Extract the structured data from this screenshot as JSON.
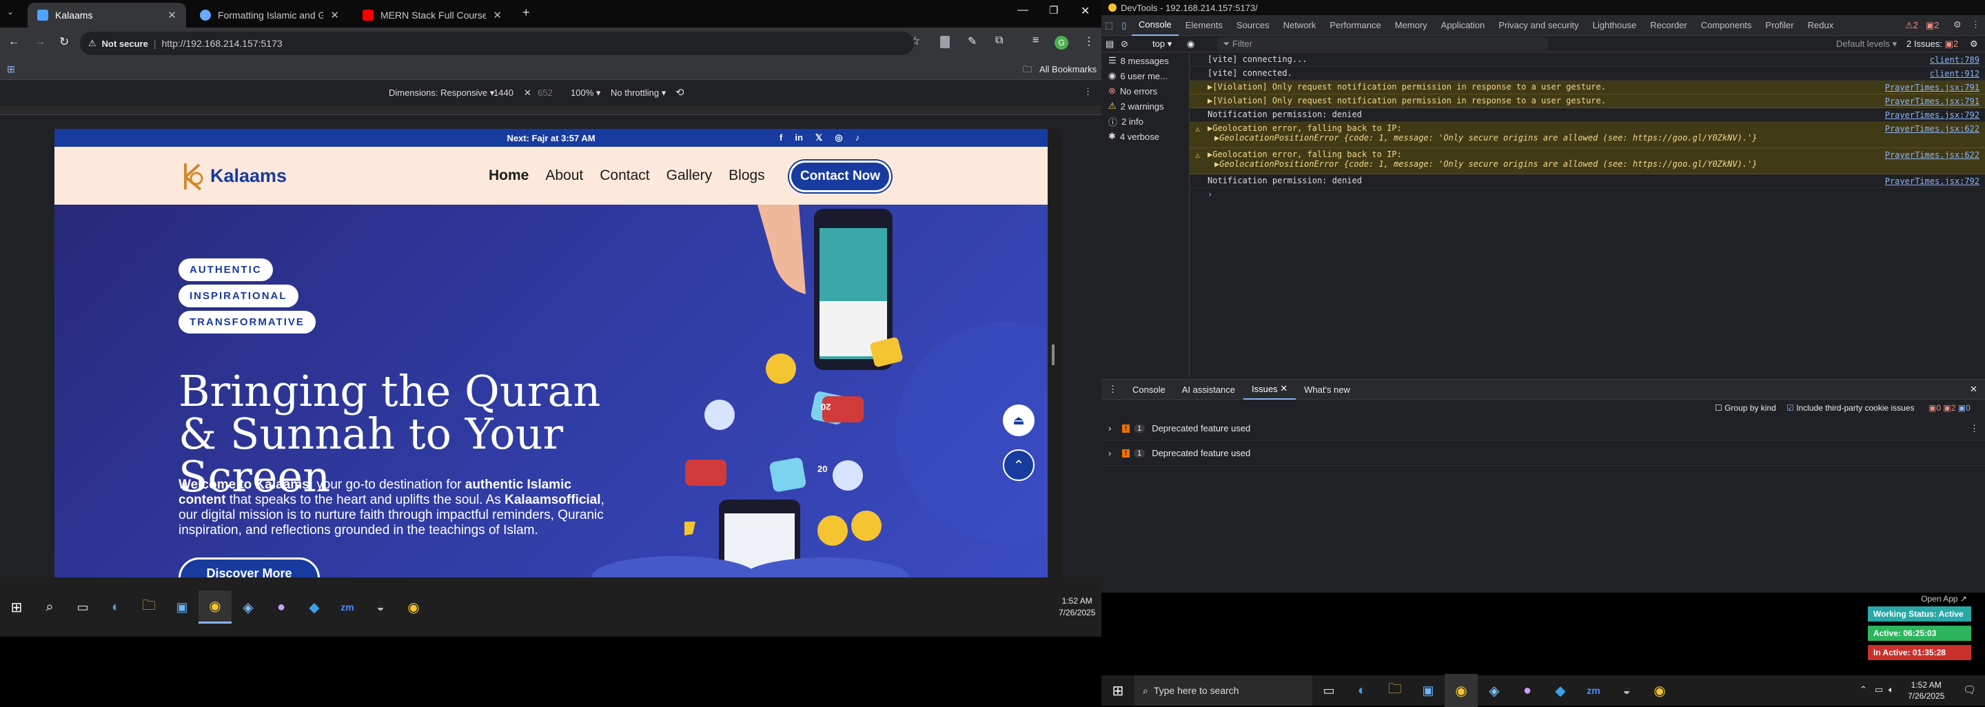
{
  "browser": {
    "tabs": [
      {
        "title": "Kalaams",
        "active": true,
        "color": "#4fa3ff"
      },
      {
        "title": "Formatting Islamic and Gregor...",
        "active": false,
        "color": "#6aa9ff"
      },
      {
        "title": "MERN Stack Full Course - ECom...",
        "active": false,
        "color": "#ff0000"
      }
    ],
    "new_tab_icon": "plus-icon",
    "security_label": "Not secure",
    "url": "http://192.168.214.157:5173",
    "all_bookmarks": "All Bookmarks",
    "device_bar": {
      "dimensions_label": "Dimensions: Responsive",
      "width": "1440",
      "height": "652",
      "zoom": "100%",
      "throttling": "No throttling"
    }
  },
  "site": {
    "announcement": "Next: Fajr at 3:57 AM",
    "social_icons": [
      "facebook-icon",
      "linkedin-icon",
      "x-icon",
      "instagram-icon",
      "tiktok-icon"
    ],
    "logo_text": "Kalaams",
    "nav": [
      "Home",
      "About",
      "Contact",
      "Gallery",
      "Blogs"
    ],
    "contact_button": "Contact Now",
    "pills": [
      "AUTHENTIC",
      "INSPIRATIONAL",
      "TRANSFORMATIVE"
    ],
    "hero_title": "Bringing the Quran & Sunnah to Your Screen",
    "hero_text": {
      "p1": "Welcome to Kalaams",
      "p2": ", your go-to destination for ",
      "p3": "authentic Islamic content",
      "p4": " that speaks to the heart and uplifts the soul. As ",
      "p5": "Kalaamsofficial",
      "p6": ", our digital mission is to nurture faith through impactful reminders, Quranic inspiration, and reflections grounded in the teachings of Islam."
    },
    "discover_button": "Discover More",
    "bubble_numbers": [
      "20",
      "20"
    ],
    "colors": {
      "announce": "#173b9e",
      "nav_bg": "#fde9dc",
      "primary": "#173b9e",
      "hero": "#2f3aa0"
    }
  },
  "taskbar_left": {
    "time": "1:52 AM",
    "date": "7/26/2025"
  },
  "devtools": {
    "title": "DevTools - 192.168.214.157:5173/",
    "tabs": [
      "Console",
      "Elements",
      "Sources",
      "Network",
      "Performance",
      "Memory",
      "Application",
      "Privacy and security",
      "Lighthouse",
      "Recorder",
      "Components",
      "Profiler",
      "Redux"
    ],
    "warning_count": "2",
    "issue_count": "2",
    "issues_label": "2 Issues:",
    "issues_badge": "2",
    "context": "top",
    "filter_placeholder": "Filter",
    "levels": "Default levels",
    "sidebar": [
      {
        "label": "8 messages",
        "icon": "list-icon"
      },
      {
        "label": "6 user me...",
        "icon": "user-icon"
      },
      {
        "label": "No errors",
        "icon": "error-icon"
      },
      {
        "label": "2 warnings",
        "icon": "warning-icon"
      },
      {
        "label": "2 info",
        "icon": "info-icon"
      },
      {
        "label": "4 verbose",
        "icon": "bug-icon"
      }
    ],
    "log": [
      {
        "text": "[vite] connecting...",
        "src": "client:789",
        "type": "log"
      },
      {
        "text": "[vite] connected.",
        "src": "client:912",
        "type": "log"
      },
      {
        "text": "▶[Violation] Only request notification permission in response to a user gesture.",
        "src": "PrayerTimes.jsx:791",
        "type": "violation"
      },
      {
        "text": "▶[Violation] Only request notification permission in response to a user gesture.",
        "src": "PrayerTimes.jsx:791",
        "type": "violation"
      },
      {
        "text": "Notification permission: denied",
        "src": "PrayerTimes.jsx:792",
        "type": "log"
      },
      {
        "text": "▶Geolocation error, falling back to IP:",
        "text2": "▶GeolocationPositionError {code: 1, message: 'Only secure origins are allowed (see: https://goo.gl/Y0ZkNV).'}",
        "src": "PrayerTimes.jsx:622",
        "type": "warn"
      },
      {
        "text": "▶Geolocation error, falling back to IP:",
        "text2": "▶GeolocationPositionError {code: 1, message: 'Only secure origins are allowed (see: https://goo.gl/Y0ZkNV).'}",
        "src": "PrayerTimes.jsx:622",
        "type": "warn"
      },
      {
        "text": "Notification permission: denied",
        "src": "PrayerTimes.jsx:792",
        "type": "log"
      }
    ],
    "prompt": "›",
    "drawer_tabs": [
      "Console",
      "AI assistance",
      "Issues",
      "What's new"
    ],
    "group_by_kind": "Group by kind",
    "include_third_party": "Include third-party cookie issues",
    "issue_counts": [
      "0",
      "2",
      "0"
    ],
    "issues": [
      {
        "count": "1",
        "label": "Deprecated feature used"
      },
      {
        "count": "1",
        "label": "Deprecated feature used"
      }
    ]
  },
  "widget": {
    "open_app": "Open App ↗",
    "working_status": "Working Status: Active",
    "active": "Active: 06:25:03",
    "inactive": "In Active: 01:35:28",
    "colors": {
      "working": "#2aa8a8",
      "active": "#2db55d",
      "inactive": "#c9302c"
    }
  },
  "taskbar_right": {
    "search_placeholder": "Type here to search",
    "time": "1:52 AM",
    "date": "7/26/2025"
  }
}
